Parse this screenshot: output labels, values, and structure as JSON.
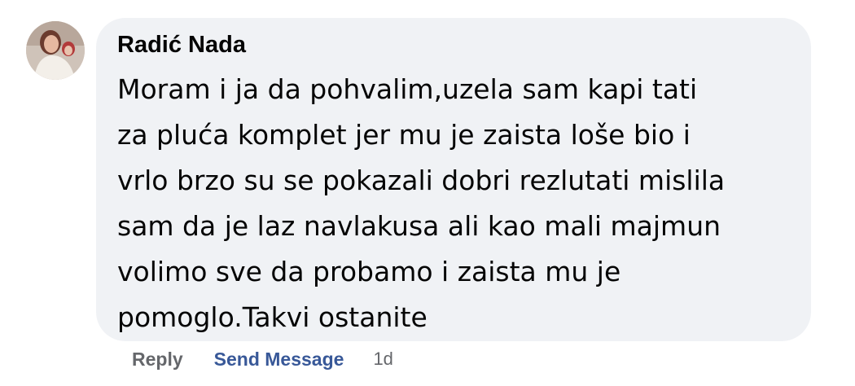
{
  "comment": {
    "author": "Radić Nada",
    "lines": [
      "Moram i ja da pohvalim,uzela sam kapi tati",
      "za pluća komplet jer mu je zaista loše bio i",
      "vrlo brzo su se pokazali dobri rezlutati mislila",
      "sam da je laz navlakusa ali kao mali majmun",
      "volimo sve da probamo i zaista mu je",
      "pomoglo.Takvi ostanite"
    ],
    "actions": {
      "reply": "Reply",
      "send_message": "Send Message",
      "timestamp": "1d"
    }
  },
  "colors": {
    "bubble_bg": "#f0f2f5",
    "text": "#050505",
    "muted": "#65676b",
    "link": "#385898"
  }
}
